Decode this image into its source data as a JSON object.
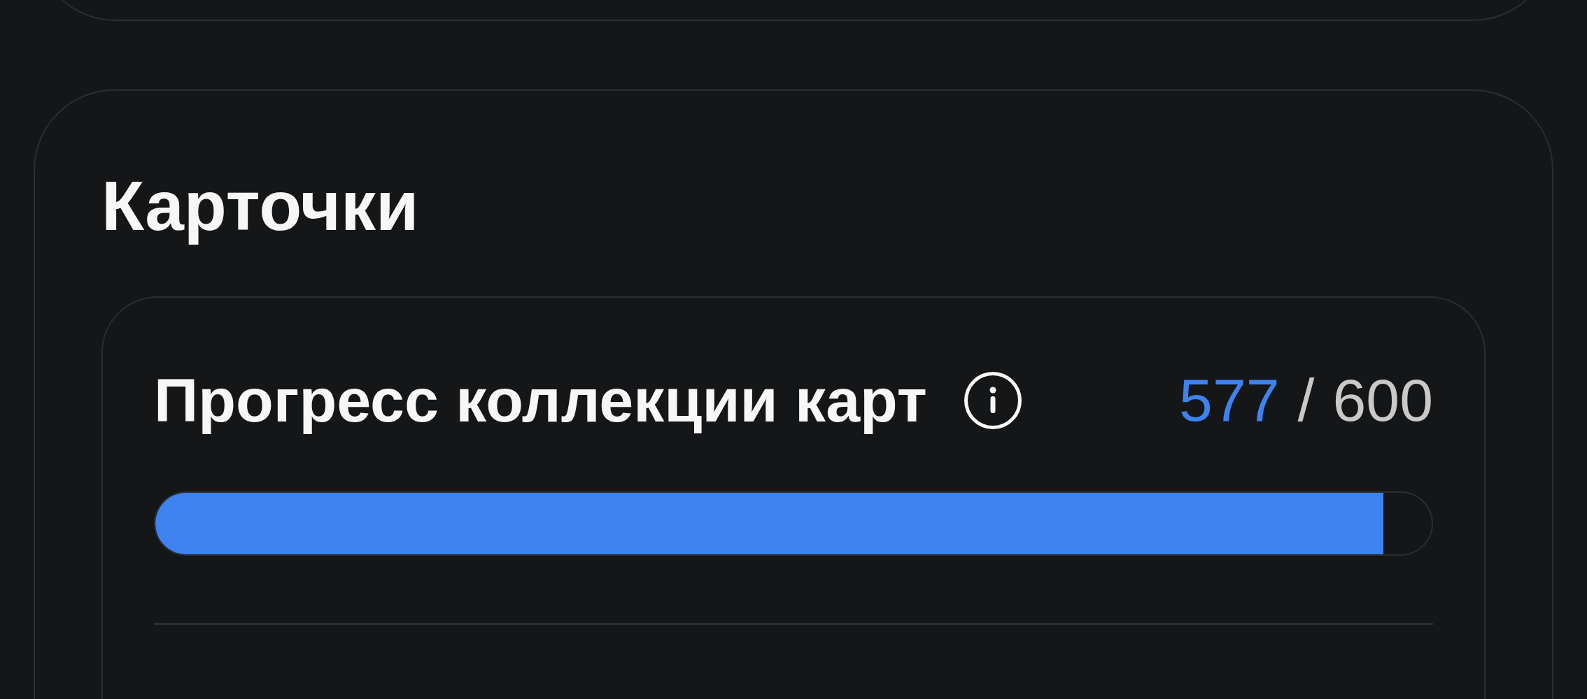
{
  "section": {
    "title": "Карточки",
    "progress_card": {
      "title": "Прогресс коллекции карт",
      "count": "577",
      "separator": "/",
      "total": "600",
      "level": 0.962
    }
  }
}
